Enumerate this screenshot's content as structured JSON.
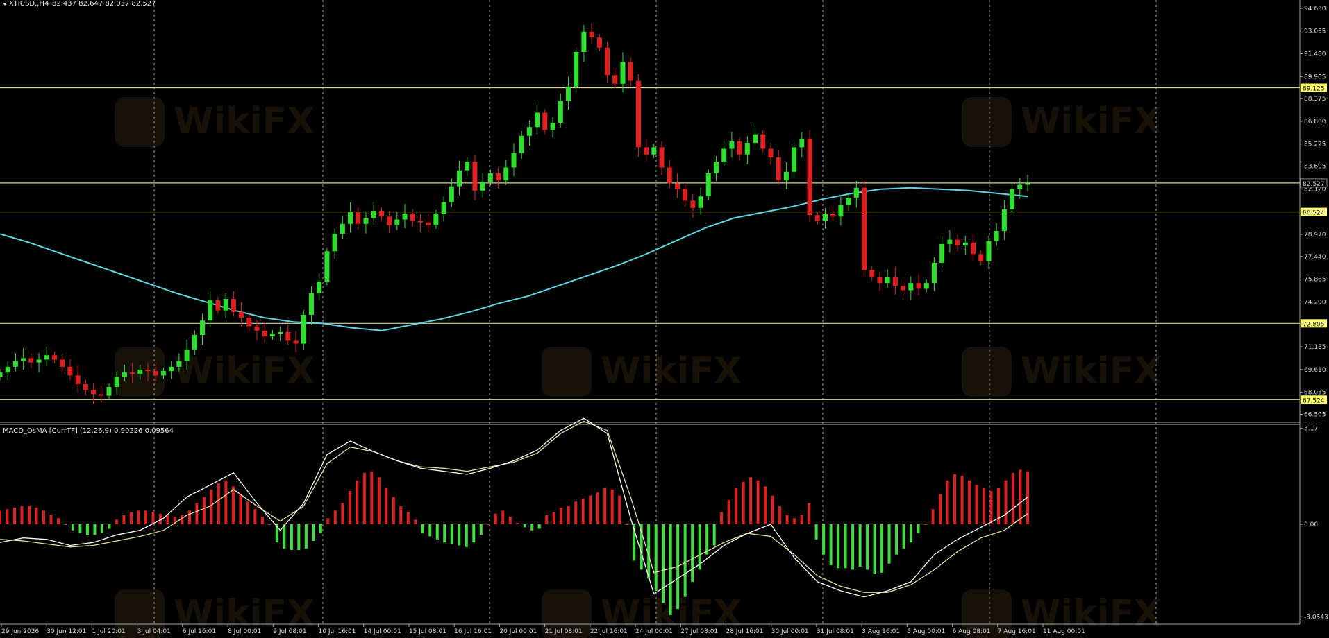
{
  "header": {
    "symbol": "XTIUSD.,H4",
    "ohlc": "82.437 82.647 82.037 82.527",
    "indicator_label": "MACD_OsMA [CurrTF] (12,26,9) 0.90226 0.09564",
    "watermark_text": "WikiFX"
  },
  "colors": {
    "background": "#000000",
    "bull": "#2ee02e",
    "bear": "#e02020",
    "ma_line": "#5fd6e6",
    "hline": "#d8d890",
    "label_box": "#ffff66",
    "grid_dash": "#cccccc",
    "hist_pos": "#e02020",
    "hist_neg": "#40e040",
    "macd_line": "#ffffff",
    "signal_line": "#e8e0a0"
  },
  "chart_data": {
    "type": "candlestick",
    "price_axis": {
      "ticks": [
        94.63,
        93.055,
        91.48,
        89.905,
        88.375,
        86.8,
        85.225,
        83.695,
        82.12,
        80.545,
        78.97,
        77.44,
        75.865,
        74.29,
        72.76,
        71.185,
        69.61,
        68.035,
        66.505
      ],
      "tick_labels": [
        "94.630",
        "93.055",
        "91.480",
        "89.905",
        "88.375",
        "86.800",
        "85.225",
        "83.695",
        "82.120",
        "80.545",
        "78.970",
        "77.440",
        "75.865",
        "74.290",
        "72.760",
        "71.185",
        "69.610",
        "68.035",
        "66.505"
      ],
      "range": [
        66.0,
        95.2
      ]
    },
    "hlines": [
      89.125,
      82.527,
      80.524,
      72.805,
      67.524
    ],
    "hline_labels": [
      "89.125",
      "82.527",
      "80.524",
      "72.805",
      "67.524"
    ],
    "time_labels": [
      "29 Jun 2026",
      "30 Jun 12:01",
      "1 Jul 20:01",
      "3 Jul 04:01",
      "6 Jul 16:01",
      "8 Jul 00:01",
      "9 Jul 08:01",
      "10 Jul 16:01",
      "14 Jul 00:01",
      "15 Jul 08:01",
      "16 Jul 16:01",
      "20 Jul 00:01",
      "21 Jul 08:01",
      "22 Jul 16:01",
      "24 Jul 00:01",
      "27 Jul 08:01",
      "28 Jul 16:01",
      "30 Jul 00:01",
      "31 Jul 08:01",
      "3 Aug 16:01",
      "5 Aug 00:01",
      "6 Aug 08:01",
      "7 Aug 16:01",
      "11 Aug 00:01"
    ],
    "close_path": [
      69.4,
      69.8,
      70.2,
      70.4,
      70.1,
      70.3,
      70.6,
      70.3,
      69.8,
      69.2,
      68.6,
      68.2,
      67.9,
      67.8,
      68.4,
      69.1,
      69.4,
      69.3,
      69.6,
      69.5,
      69.2,
      69.5,
      69.8,
      70.2,
      71.0,
      72.0,
      73.0,
      74.4,
      73.7,
      74.5,
      73.6,
      73.2,
      72.6,
      72.3,
      71.9,
      72.1,
      72.2,
      71.6,
      71.4,
      73.4,
      74.9,
      75.7,
      77.8,
      79.0,
      79.7,
      80.5,
      79.7,
      80.1,
      80.6,
      80.2,
      79.6,
      80.0,
      80.4,
      79.9,
      79.8,
      79.6,
      80.4,
      81.2,
      82.3,
      83.4,
      84.0,
      82.0,
      82.6,
      83.2,
      82.7,
      83.6,
      84.6,
      85.8,
      86.4,
      87.4,
      86.2,
      86.7,
      88.2,
      89.2,
      91.6,
      93.0,
      92.6,
      91.9,
      90.0,
      89.4,
      90.9,
      89.6,
      85.0,
      84.5,
      85.0,
      83.6,
      82.5,
      82.1,
      81.3,
      80.8,
      81.6,
      83.2,
      84.0,
      84.9,
      85.4,
      84.5,
      85.3,
      85.9,
      84.9,
      84.3,
      82.7,
      83.3,
      85.0,
      85.6,
      80.3,
      79.9,
      80.4,
      80.2,
      81.0,
      81.5,
      82.2,
      76.5,
      76.0,
      75.6,
      76.0,
      75.4,
      75.1,
      75.6,
      75.2,
      75.6,
      77.0,
      78.3,
      78.6,
      78.2,
      78.4,
      77.6,
      77.1,
      78.5,
      79.2,
      80.7,
      82.1,
      82.4,
      82.5
    ],
    "ma_path": [
      79.0,
      78.4,
      77.7,
      77.0,
      76.3,
      75.6,
      74.9,
      74.3,
      73.7,
      73.2,
      72.9,
      72.8,
      72.5,
      72.3,
      72.7,
      73.1,
      73.6,
      74.2,
      74.7,
      75.4,
      76.1,
      76.8,
      77.6,
      78.5,
      79.4,
      80.1,
      80.5,
      80.9,
      81.4,
      81.8,
      82.1,
      82.2,
      82.1,
      82.0,
      81.8,
      81.6
    ],
    "macd_axis": {
      "ticks": [
        3.17,
        0.0,
        -3.05431
      ],
      "tick_labels": [
        "3.17",
        "0.00",
        "-3.05431"
      ],
      "range": [
        -3.3,
        3.3
      ]
    },
    "macd_hist": [
      0.45,
      0.5,
      0.55,
      0.6,
      0.6,
      0.55,
      0.45,
      0.3,
      0.2,
      0.0,
      -0.2,
      -0.3,
      -0.35,
      -0.35,
      -0.3,
      -0.15,
      0.15,
      0.3,
      0.4,
      0.45,
      0.45,
      0.4,
      0.35,
      0.3,
      0.25,
      0.3,
      0.45,
      0.7,
      0.9,
      1.15,
      1.35,
      1.45,
      1.25,
      1.0,
      0.75,
      0.5,
      0.25,
      0.0,
      -0.6,
      -0.8,
      -0.85,
      -0.85,
      -0.8,
      -0.55,
      -0.3,
      0.2,
      0.45,
      0.7,
      1.1,
      1.45,
      1.7,
      1.75,
      1.55,
      1.2,
      0.9,
      0.6,
      0.4,
      0.15,
      -0.3,
      -0.4,
      -0.5,
      -0.6,
      -0.65,
      -0.7,
      -0.75,
      -0.6,
      -0.35,
      0.0,
      0.35,
      0.45,
      0.25,
      0.05,
      -0.1,
      -0.2,
      -0.15,
      0.3,
      0.4,
      0.55,
      0.6,
      0.75,
      0.85,
      0.95,
      1.05,
      1.2,
      1.15,
      0.95,
      0.0,
      -1.2,
      -1.5,
      -1.8,
      -2.2,
      -2.6,
      -3.0,
      -2.8,
      -2.4,
      -1.9,
      -1.5,
      -1.0,
      -0.7,
      0.4,
      0.8,
      1.2,
      1.4,
      1.55,
      1.45,
      1.25,
      0.95,
      0.6,
      0.3,
      0.2,
      0.3,
      0.7,
      -0.5,
      -1.0,
      -1.35,
      -1.45,
      -1.45,
      -1.5,
      -1.4,
      -1.5,
      -1.65,
      -1.6,
      -1.3,
      -1.0,
      -0.8,
      -0.6,
      -0.3,
      0.0,
      0.5,
      1.0,
      1.45,
      1.65,
      1.6,
      1.45,
      1.3,
      1.2,
      1.1,
      1.2,
      1.45,
      1.7,
      1.8,
      1.75
    ],
    "macd_line": [
      -0.6,
      -0.45,
      -0.5,
      -0.7,
      -0.6,
      -0.35,
      -0.2,
      0.2,
      0.9,
      1.3,
      1.7,
      0.7,
      -0.2,
      0.7,
      2.3,
      2.75,
      2.4,
      2.1,
      1.85,
      1.75,
      1.65,
      1.85,
      2.1,
      2.45,
      3.1,
      3.5,
      3.0,
      0.2,
      -2.3,
      -1.8,
      -1.3,
      -0.7,
      -0.3,
      0.0,
      -1.1,
      -1.9,
      -2.2,
      -2.4,
      -2.2,
      -1.9,
      -1.0,
      -0.5,
      -0.1,
      0.3,
      0.9
    ],
    "signal_line": [
      -0.5,
      -0.55,
      -0.65,
      -0.75,
      -0.7,
      -0.55,
      -0.4,
      -0.2,
      0.3,
      0.6,
      1.15,
      0.6,
      0.1,
      0.6,
      2.0,
      2.55,
      2.4,
      2.1,
      1.9,
      1.85,
      1.75,
      1.9,
      2.05,
      2.35,
      3.0,
      3.4,
      3.1,
      0.9,
      -1.6,
      -1.4,
      -1.0,
      -0.6,
      -0.3,
      -0.4,
      -1.0,
      -1.7,
      -2.05,
      -2.25,
      -2.25,
      -2.0,
      -1.5,
      -0.9,
      -0.45,
      -0.2,
      0.35
    ]
  }
}
